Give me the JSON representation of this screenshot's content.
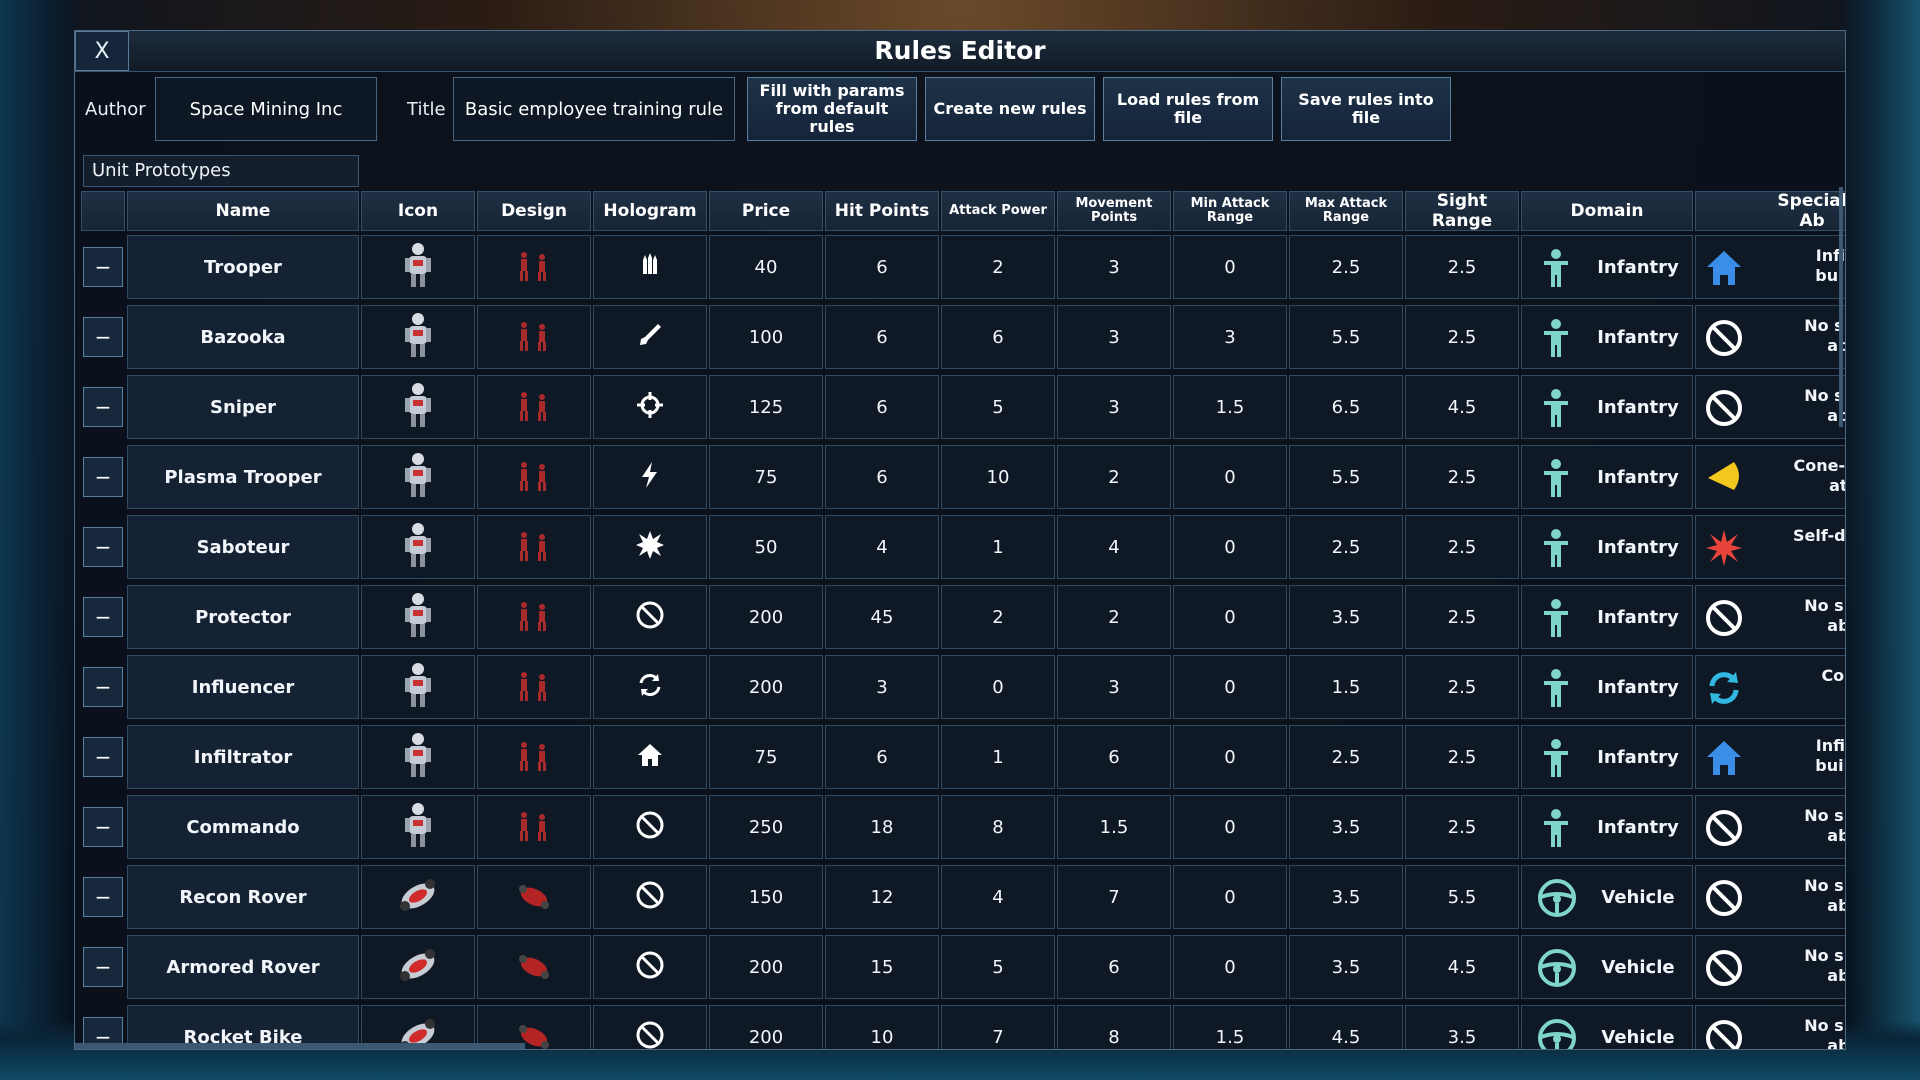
{
  "window": {
    "title": "Rules Editor",
    "close_label": "X"
  },
  "toolbar": {
    "author_label": "Author",
    "author_value": "Space Mining Inc",
    "title_label": "Title",
    "title_value": "Basic employee training rule",
    "fill_button": "Fill with params from default rules",
    "create_button": "Create new rules",
    "load_button": "Load rules from file",
    "save_button": "Save rules into file"
  },
  "section": {
    "label": "Unit Prototypes"
  },
  "columns": {
    "name": "Name",
    "icon": "Icon",
    "design": "Design",
    "hologram": "Hologram",
    "price": "Price",
    "hit_points": "Hit Points",
    "attack_power": "Attack Power",
    "movement_points": "Movement Points",
    "min_attack_range": "Min Attack Range",
    "max_attack_range": "Max Attack Range",
    "sight_range": "Sight Range",
    "domain": "Domain",
    "special": "Special Ab"
  },
  "colors": {
    "accent": "#5a7e9e",
    "infantry_icon": "#7fd6c8",
    "house_icon": "#3a8ee8",
    "cone_icon": "#f2c81e",
    "burst_icon": "#e8443c",
    "convert_icon": "#31b7e0"
  },
  "rows": [
    {
      "remove": "−",
      "name": "Trooper",
      "hologram_icon": "ammo-icon",
      "price": "40",
      "hp": "6",
      "attack": "2",
      "movement": "3",
      "min_range": "0",
      "max_range": "2.5",
      "sight": "2.5",
      "domain": "Infantry",
      "domain_icon": "infantry-icon",
      "special": "Infiltr\nbuildi",
      "special_icon": "house-icon"
    },
    {
      "remove": "−",
      "name": "Bazooka",
      "hologram_icon": "rocket-icon",
      "price": "100",
      "hp": "6",
      "attack": "6",
      "movement": "3",
      "min_range": "3",
      "max_range": "5.5",
      "sight": "2.5",
      "domain": "Infantry",
      "domain_icon": "infantry-icon",
      "special": "No spe\nabili",
      "special_icon": "no-icon"
    },
    {
      "remove": "−",
      "name": "Sniper",
      "hologram_icon": "crosshair-icon",
      "price": "125",
      "hp": "6",
      "attack": "5",
      "movement": "3",
      "min_range": "1.5",
      "max_range": "6.5",
      "sight": "4.5",
      "domain": "Infantry",
      "domain_icon": "infantry-icon",
      "special": "No spe\nabili",
      "special_icon": "no-icon"
    },
    {
      "remove": "−",
      "name": "Plasma Trooper",
      "hologram_icon": "lightning-icon",
      "price": "75",
      "hp": "6",
      "attack": "10",
      "movement": "2",
      "min_range": "0",
      "max_range": "5.5",
      "sight": "2.5",
      "domain": "Infantry",
      "domain_icon": "infantry-icon",
      "special": "Cone-sh\natta",
      "special_icon": "cone-icon"
    },
    {
      "remove": "−",
      "name": "Saboteur",
      "hologram_icon": "explosion-icon",
      "price": "50",
      "hp": "4",
      "attack": "1",
      "movement": "4",
      "min_range": "0",
      "max_range": "2.5",
      "sight": "2.5",
      "domain": "Infantry",
      "domain_icon": "infantry-icon",
      "special": "Self-des",
      "special_icon": "burst-icon"
    },
    {
      "remove": "−",
      "name": "Protector",
      "hologram_icon": "no-icon",
      "price": "200",
      "hp": "45",
      "attack": "2",
      "movement": "2",
      "min_range": "0",
      "max_range": "3.5",
      "sight": "2.5",
      "domain": "Infantry",
      "domain_icon": "infantry-icon",
      "special": "No spe\nabili",
      "special_icon": "no-icon"
    },
    {
      "remove": "−",
      "name": "Influencer",
      "hologram_icon": "refresh-icon",
      "price": "200",
      "hp": "3",
      "attack": "0",
      "movement": "3",
      "min_range": "0",
      "max_range": "1.5",
      "sight": "2.5",
      "domain": "Infantry",
      "domain_icon": "infantry-icon",
      "special": "Conv",
      "special_icon": "convert-icon"
    },
    {
      "remove": "−",
      "name": "Infiltrator",
      "hologram_icon": "house-icon",
      "price": "75",
      "hp": "6",
      "attack": "1",
      "movement": "6",
      "min_range": "0",
      "max_range": "2.5",
      "sight": "2.5",
      "domain": "Infantry",
      "domain_icon": "infantry-icon",
      "special": "Infiltr\nbuildi",
      "special_icon": "house-icon"
    },
    {
      "remove": "−",
      "name": "Commando",
      "hologram_icon": "no-icon",
      "price": "250",
      "hp": "18",
      "attack": "8",
      "movement": "1.5",
      "min_range": "0",
      "max_range": "3.5",
      "sight": "2.5",
      "domain": "Infantry",
      "domain_icon": "infantry-icon",
      "special": "No spe\nabili",
      "special_icon": "no-icon"
    },
    {
      "remove": "−",
      "name": "Recon Rover",
      "hologram_icon": "no-icon",
      "price": "150",
      "hp": "12",
      "attack": "4",
      "movement": "7",
      "min_range": "0",
      "max_range": "3.5",
      "sight": "5.5",
      "domain": "Vehicle",
      "domain_icon": "wheel-icon",
      "special": "No spe\nabili",
      "special_icon": "no-icon"
    },
    {
      "remove": "−",
      "name": "Armored Rover",
      "hologram_icon": "no-icon",
      "price": "200",
      "hp": "15",
      "attack": "5",
      "movement": "6",
      "min_range": "0",
      "max_range": "3.5",
      "sight": "4.5",
      "domain": "Vehicle",
      "domain_icon": "wheel-icon",
      "special": "No spe\nabili",
      "special_icon": "no-icon"
    },
    {
      "remove": "−",
      "name": "Rocket Bike",
      "hologram_icon": "no-icon",
      "price": "200",
      "hp": "10",
      "attack": "7",
      "movement": "8",
      "min_range": "1.5",
      "max_range": "4.5",
      "sight": "3.5",
      "domain": "Vehicle",
      "domain_icon": "wheel-icon",
      "special": "No spe\nabili",
      "special_icon": "no-icon"
    }
  ]
}
